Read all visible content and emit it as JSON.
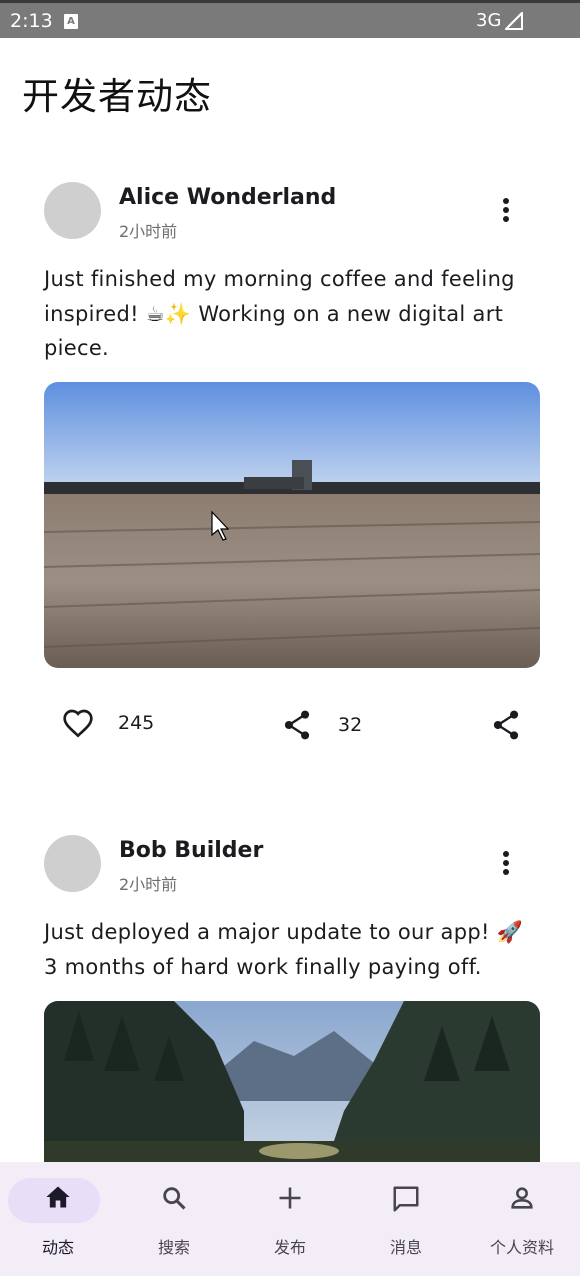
{
  "status_bar": {
    "time": "2:13",
    "network": "3G"
  },
  "page": {
    "title": "开发者动态"
  },
  "posts": [
    {
      "author": "Alice Wonderland",
      "time": "2小时前",
      "text": "Just finished my morning coffee and feeling inspired! ☕✨ Working on a new digital art piece.",
      "likes": "245",
      "shares": "32"
    },
    {
      "author": "Bob Builder",
      "time": "2小时前",
      "text": "Just deployed a major update to our app! 🚀 3 months of hard work finally paying off."
    }
  ],
  "nav": {
    "items": [
      {
        "label": "动态",
        "icon": "home-icon",
        "active": true
      },
      {
        "label": "搜索",
        "icon": "search-icon"
      },
      {
        "label": "发布",
        "icon": "add-icon"
      },
      {
        "label": "消息",
        "icon": "message-icon"
      },
      {
        "label": "个人资料",
        "icon": "person-icon"
      }
    ]
  },
  "colors": {
    "nav_background": "#f3edf7",
    "nav_active_pill": "#e8def8",
    "avatar": "#cfcfcf"
  }
}
